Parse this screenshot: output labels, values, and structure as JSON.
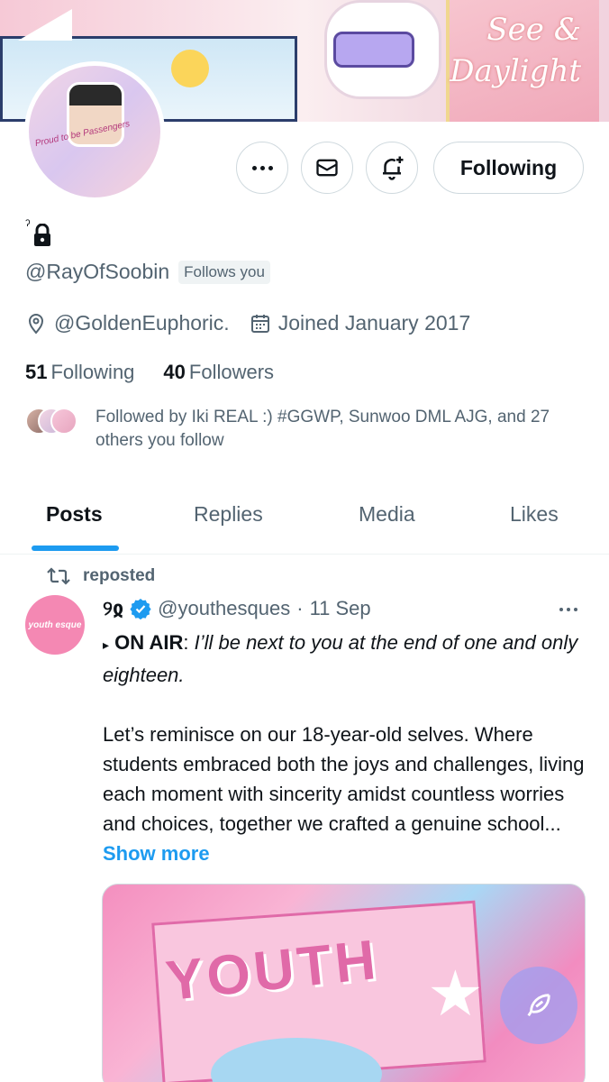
{
  "profile": {
    "handle": "@RayOfSoobin",
    "follows_you_badge": "Follows you",
    "location": "@GoldenEuphoric.",
    "joined": "Joined January 2017",
    "following_count": "51",
    "following_label": "Following",
    "followers_count": "40",
    "followers_label": "Followers",
    "followed_by": "Followed by Iki REAL :) #GGWP, Sunwoo DML AJG, and 27 others you follow",
    "avatar_caption": "Proud to be Passengers"
  },
  "banner": {
    "poster_text": "See & Daylight"
  },
  "actions": {
    "following_button": "Following",
    "more_icon": "more-horizontal-icon",
    "message_icon": "envelope-icon",
    "notify_icon": "bell-plus-icon"
  },
  "tabs": [
    {
      "label": "Posts",
      "active": true
    },
    {
      "label": "Replies",
      "active": false
    },
    {
      "label": "Media",
      "active": false
    },
    {
      "label": "Likes",
      "active": false
    }
  ],
  "post": {
    "repost_label": "reposted",
    "author_name": "୨ჲ",
    "author_handle": "@youthesques",
    "separator": "·",
    "date": "11 Sep",
    "avatar_text": "youth esque",
    "arrow": "▸",
    "on_air_label": "ON AIR",
    "colon": ":",
    "quote": "I’ll be next to you at the end of one and only eighteen.",
    "body": "Let’s reminisce on our 18-year-old selves. Where students embraced both the joys and challenges, living each moment with sincerity amidst countless worries and choices, together we crafted a genuine school...",
    "show_more": "Show more",
    "media_title": "YOUTH"
  },
  "colors": {
    "accent": "#1d9bf0",
    "text_primary": "#0f1419",
    "text_secondary": "#536471",
    "border": "#cfd9de",
    "verified": "#1d9bf0"
  }
}
